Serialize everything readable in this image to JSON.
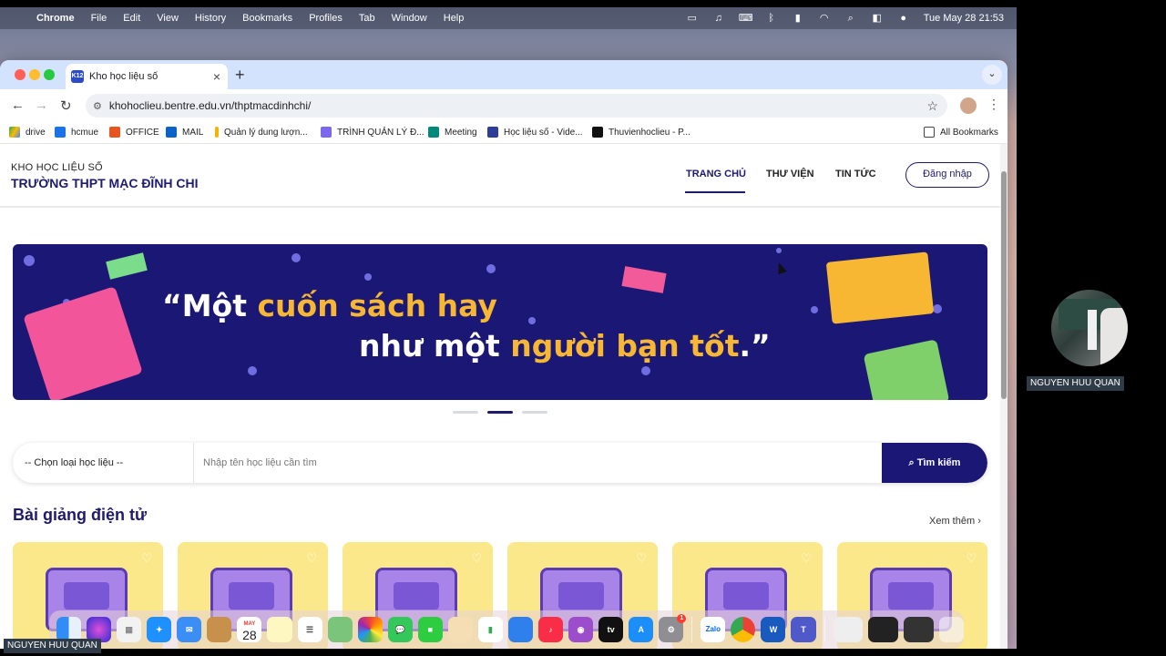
{
  "menubar": {
    "app": "Chrome",
    "items": [
      "File",
      "Edit",
      "View",
      "History",
      "Bookmarks",
      "Profiles",
      "Tab",
      "Window",
      "Help"
    ],
    "clock": "Tue May 28  21:53"
  },
  "browser": {
    "tab_title": "Kho học liệu số",
    "favicon_text": "K12",
    "url": "khohoclieu.bentre.edu.vn/thptmacdinhchi/"
  },
  "bookmarks": {
    "items": [
      "drive",
      "hcmue",
      "OFFICE",
      "MAIL",
      "Quản lý dung lượn...",
      "TRÌNH QUẢN LÝ Đ...",
      "Meeting",
      "Học liệu số - Vide...",
      "Thuvienhoclieu - P..."
    ],
    "all_label": "All Bookmarks"
  },
  "site": {
    "brand_small": "KHO HỌC LIỆU SỐ",
    "brand_big": "TRƯỜNG THPT MẠC ĐĨNH CHI",
    "nav": [
      "TRANG CHỦ",
      "THƯ VIỆN",
      "TIN TỨC"
    ],
    "login": "Đăng nhập"
  },
  "banner": {
    "line1_a": "“Một ",
    "line1_b": "cuốn sách hay",
    "line2_a": "như một ",
    "line2_b": "người bạn tốt",
    "line2_c": ".”"
  },
  "search": {
    "type_select": "-- Chọn loại học liệu --",
    "placeholder": "Nhập tên học liệu cần tìm",
    "button": "Tìm kiếm"
  },
  "section": {
    "title": "Bài giảng điện tử",
    "see_more": "Xem thêm"
  },
  "dock": {
    "calendar_month": "MAY",
    "calendar_day": "28",
    "zalo": "Zalo",
    "appstore_badge": "1"
  },
  "video": {
    "participant": "NGUYEN HUU QUAN",
    "self_label": "NGUYEN HUU QUAN"
  }
}
